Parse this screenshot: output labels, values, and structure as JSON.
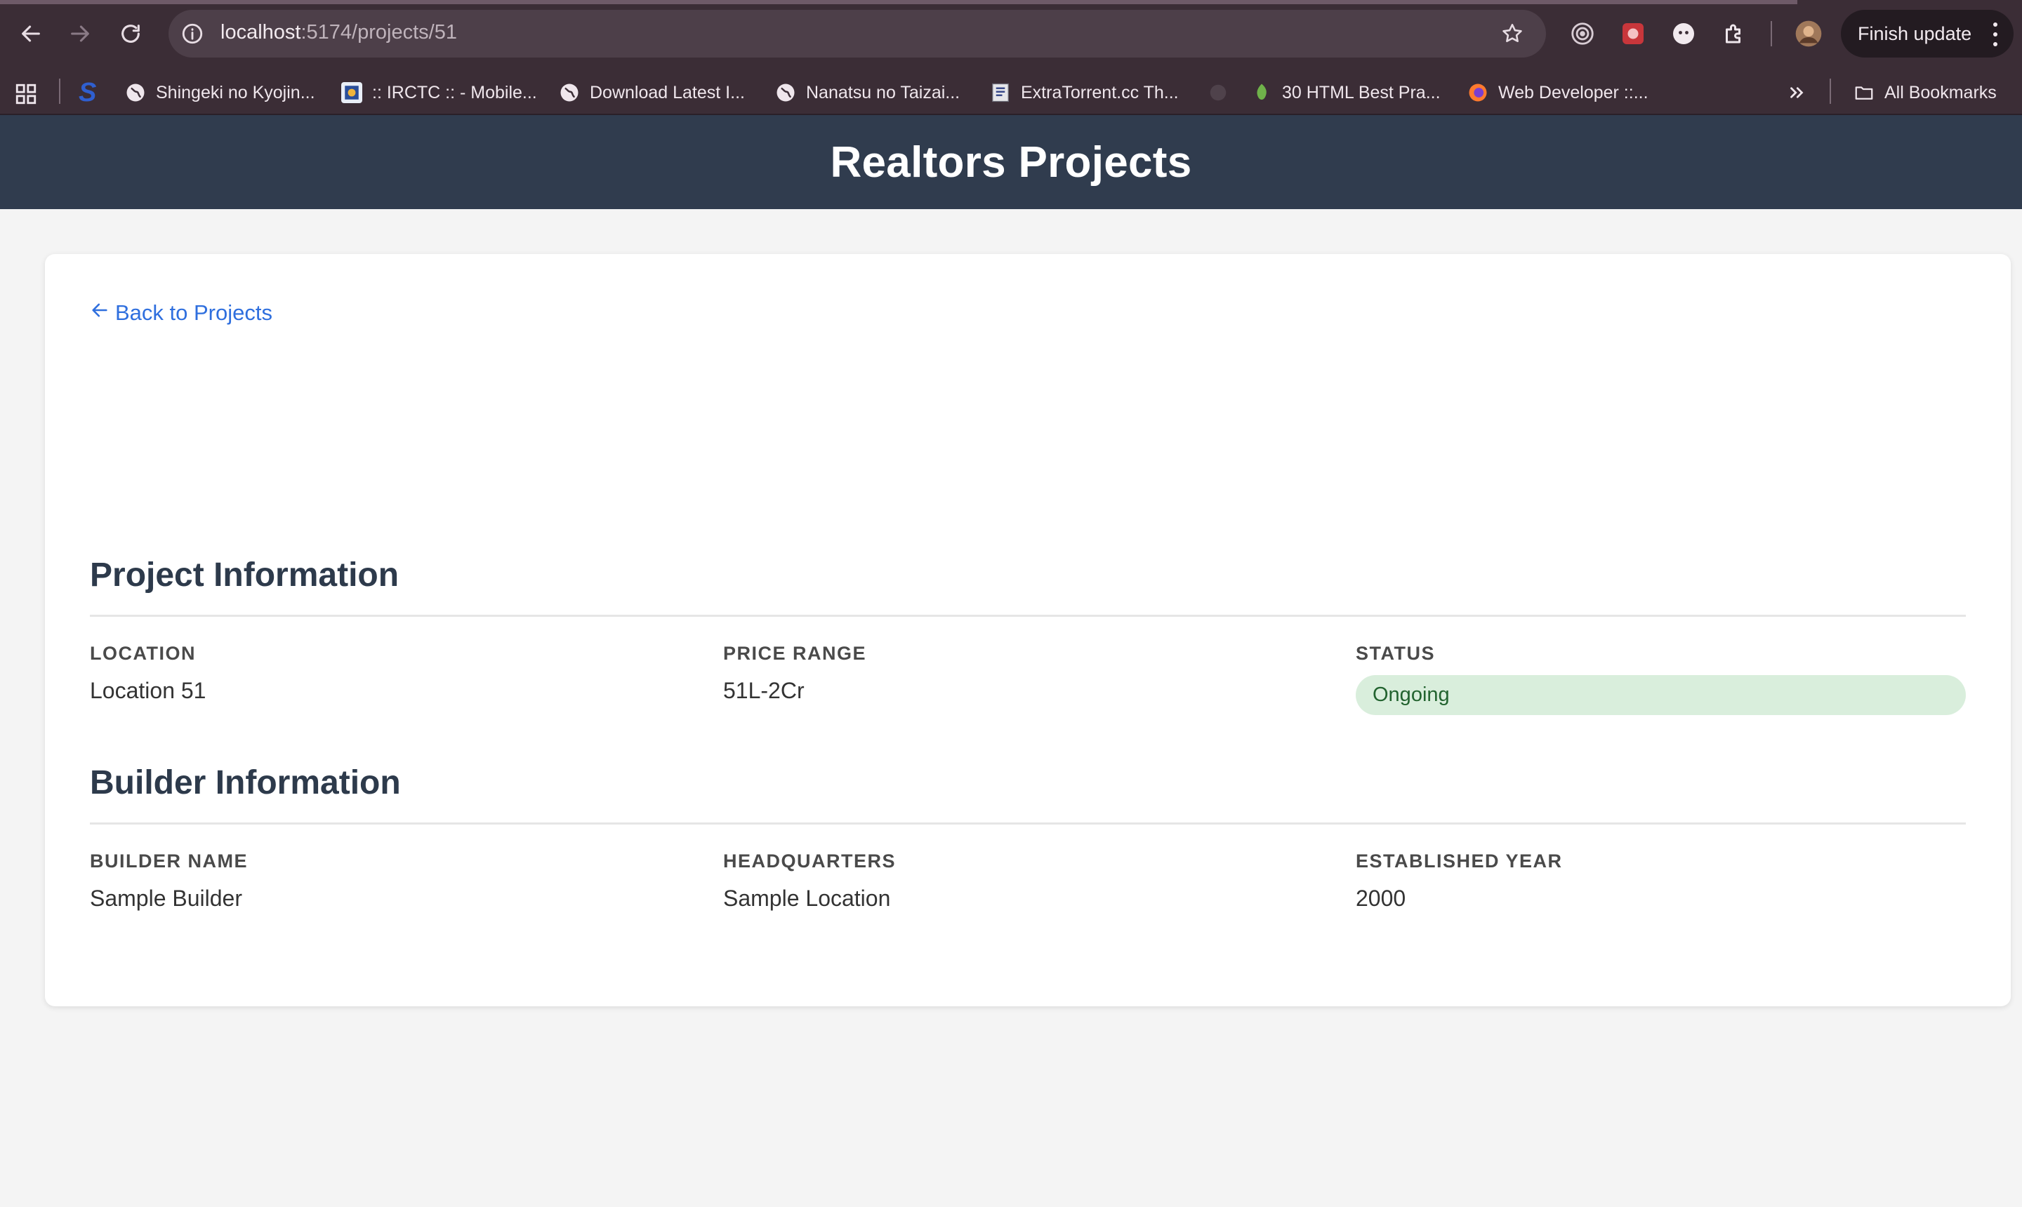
{
  "browser": {
    "url_host": "localhost",
    "url_path": ":5174/projects/51",
    "finish_update_label": "Finish update",
    "bookmarks": [
      {
        "label": "Shingeki no Kyojin...",
        "icon": "globe-icon"
      },
      {
        "label": ":: IRCTC :: - Mobile...",
        "icon": "irctc-icon"
      },
      {
        "label": "Download Latest I...",
        "icon": "globe-icon"
      },
      {
        "label": "Nanatsu no Taizai...",
        "icon": "globe-icon"
      },
      {
        "label": "ExtraTorrent.cc Th...",
        "icon": "document-icon"
      },
      {
        "label": "30 HTML Best Pra...",
        "icon": "leaf-icon"
      },
      {
        "label": "Web Developer ::...",
        "icon": "firefox-icon"
      }
    ],
    "all_bookmarks_label": "All Bookmarks"
  },
  "header": {
    "title": "Realtors Projects",
    "background_color": "#303c4e"
  },
  "page": {
    "back_link": "Back to Projects",
    "project_section": {
      "title": "Project Information",
      "fields": [
        {
          "label": "LOCATION",
          "value": "Location 51"
        },
        {
          "label": "PRICE RANGE",
          "value": "51L-2Cr"
        },
        {
          "label": "STATUS",
          "value": "Ongoing"
        }
      ]
    },
    "builder_section": {
      "title": "Builder Information",
      "fields": [
        {
          "label": "BUILDER NAME",
          "value": "Sample Builder"
        },
        {
          "label": "HEADQUARTERS",
          "value": "Sample Location"
        },
        {
          "label": "ESTABLISHED YEAR",
          "value": "2000"
        }
      ]
    },
    "status_color": "#d9eedc",
    "link_color": "#2f6fde"
  }
}
